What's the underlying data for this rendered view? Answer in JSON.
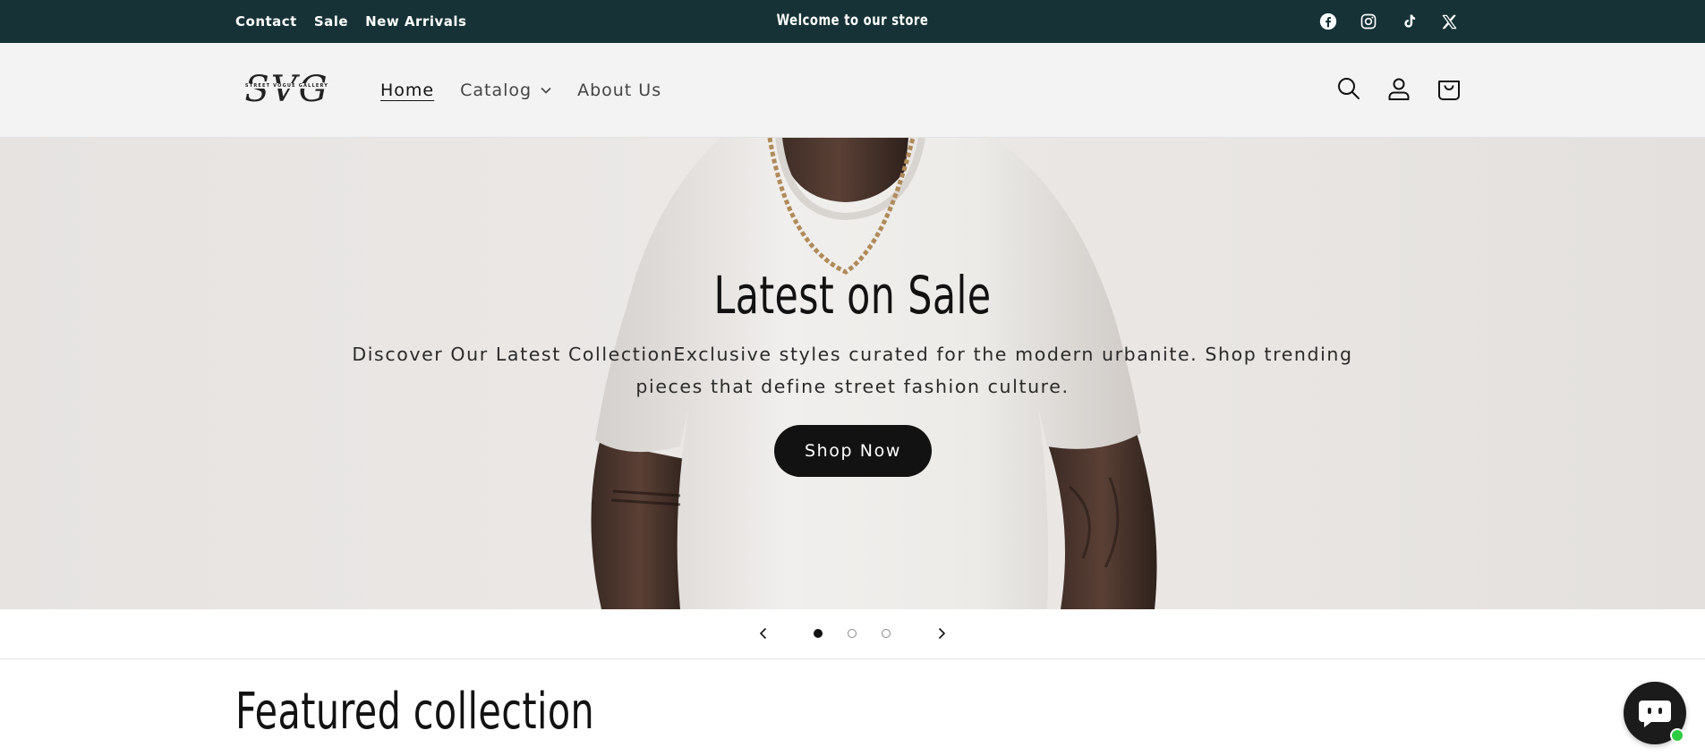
{
  "announcement": {
    "links": [
      "Contact",
      "Sale",
      "New Arrivals"
    ],
    "message": "Welcome to our store",
    "social_icons": [
      "facebook-icon",
      "instagram-icon",
      "tiktok-icon",
      "x-icon"
    ],
    "background_color": "#163236"
  },
  "header": {
    "logo_text": "SVG",
    "logo_tagline": "STREET VOGUE GALLERY",
    "nav": [
      {
        "label": "Home",
        "active": true
      },
      {
        "label": "Catalog",
        "has_dropdown": true
      },
      {
        "label": "About Us"
      }
    ],
    "tool_icons": [
      "search-icon",
      "account-icon",
      "cart-icon"
    ]
  },
  "hero": {
    "title": "Latest on Sale",
    "description": "Discover Our Latest CollectionExclusive styles curated for the modern urbanite. Shop trending pieces that define street fashion culture.",
    "button_label": "Shop Now",
    "slides_count": 3,
    "active_slide": 1
  },
  "featured": {
    "title": "Featured collection"
  },
  "chat": {
    "icon": "chat-icon",
    "status_color": "#2ecc40"
  }
}
